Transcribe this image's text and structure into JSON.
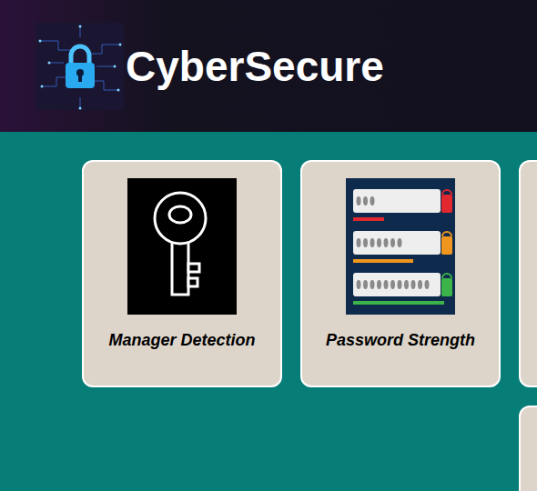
{
  "header": {
    "title": "CyberSecure"
  },
  "cards": [
    {
      "label": "Manager Detection",
      "kind": "key"
    },
    {
      "label": "Password Strength",
      "kind": "strength"
    },
    {
      "label": "",
      "kind": "hidden"
    },
    {
      "label": "",
      "kind": "hidden"
    },
    {
      "label": "",
      "kind": "hidden"
    },
    {
      "label": "",
      "kind": "hidden"
    }
  ]
}
